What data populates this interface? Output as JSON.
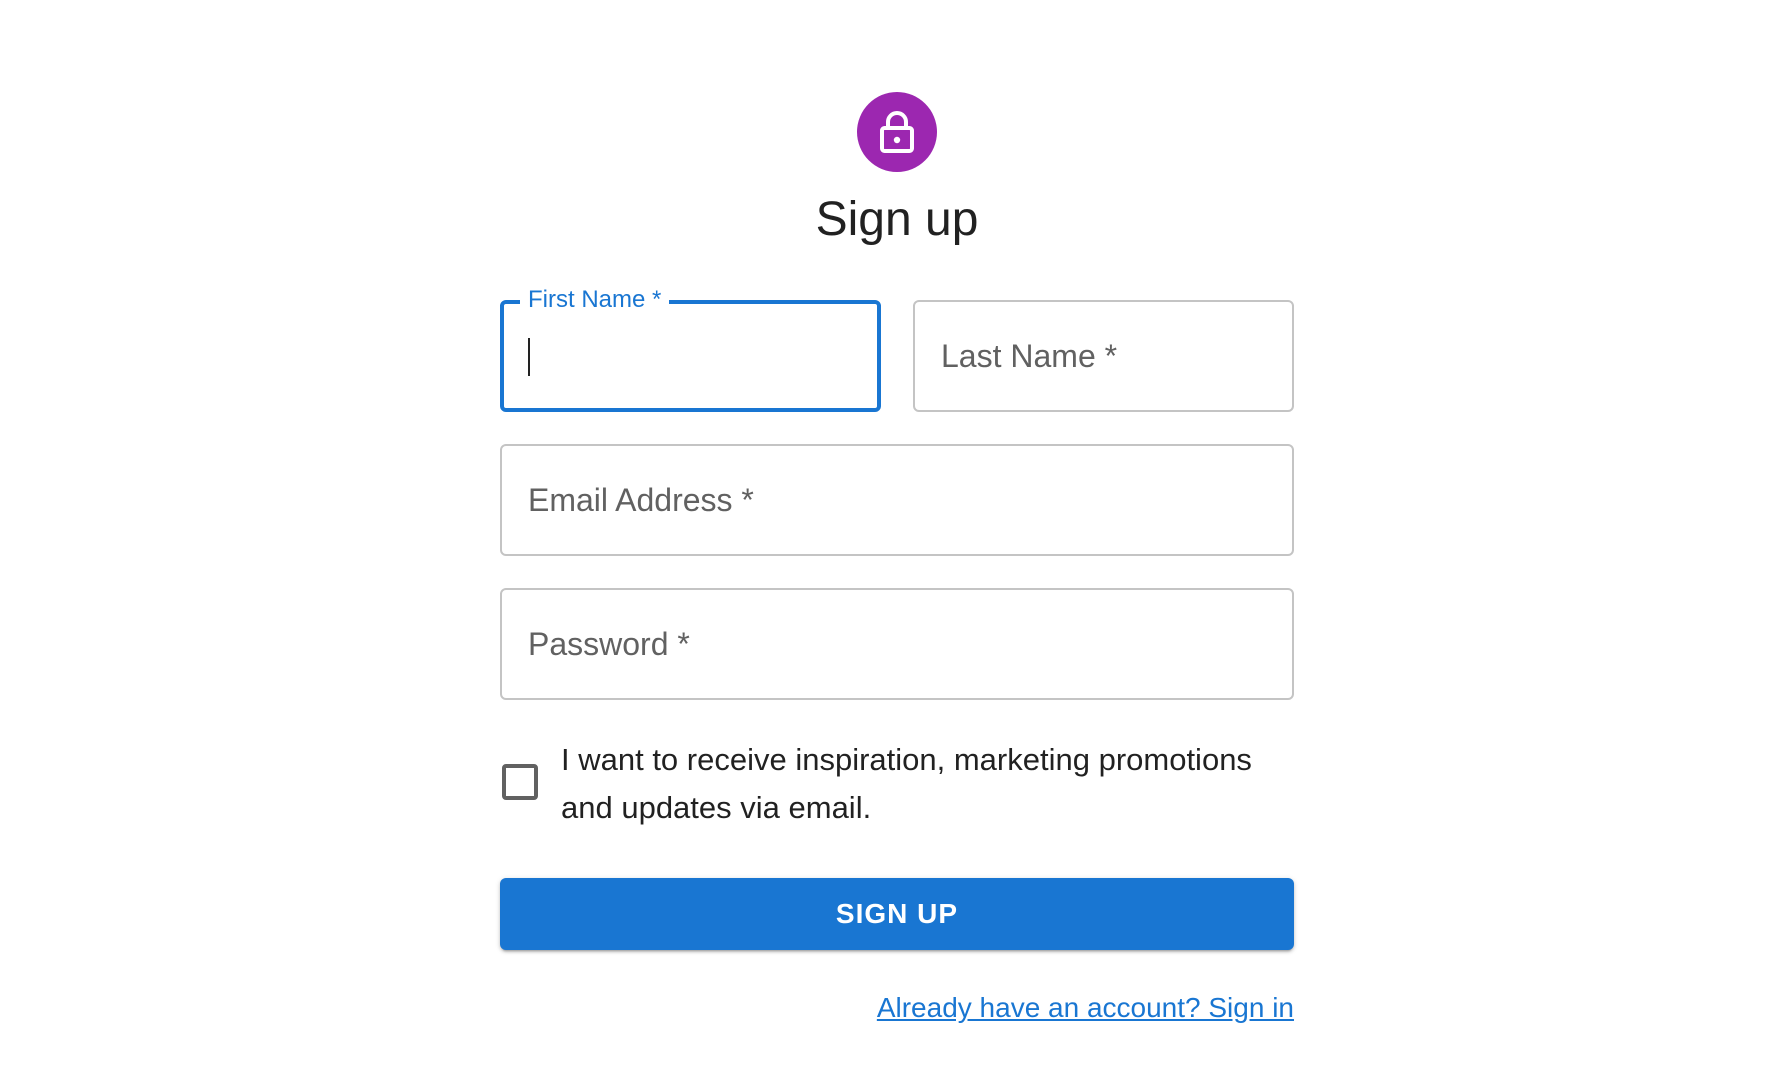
{
  "header": {
    "avatar_icon": "lock-icon",
    "avatar_color": "#9c27b0",
    "title": "Sign up"
  },
  "form": {
    "first_name": {
      "label": "First Name *",
      "value": "",
      "focused": true
    },
    "last_name": {
      "label": "Last Name *",
      "value": ""
    },
    "email": {
      "label": "Email Address *",
      "value": ""
    },
    "password": {
      "label": "Password *",
      "value": ""
    },
    "marketing_checkbox": {
      "label": "I want to receive inspiration, marketing promotions and updates via email.",
      "checked": false
    },
    "submit_label": "SIGN UP",
    "signin_link": "Already have an account? Sign in"
  },
  "colors": {
    "primary": "#1976d2",
    "avatar": "#9c27b0",
    "border": "#c4c4c4"
  }
}
